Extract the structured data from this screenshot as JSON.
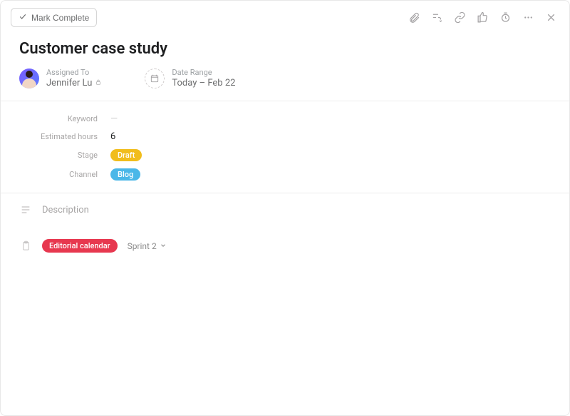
{
  "toolbar": {
    "mark_complete_label": "Mark Complete"
  },
  "task": {
    "title": "Customer case study",
    "assignee": {
      "label": "Assigned To",
      "name": "Jennifer Lu"
    },
    "date_range": {
      "label": "Date Range",
      "value": "Today – Feb 22"
    },
    "fields": {
      "keyword": {
        "label": "Keyword",
        "value": "—"
      },
      "estimated_hours": {
        "label": "Estimated hours",
        "value": "6"
      },
      "stage": {
        "label": "Stage",
        "pill": "Draft",
        "pill_color": "yellow"
      },
      "channel": {
        "label": "Channel",
        "pill": "Blog",
        "pill_color": "blue"
      }
    },
    "description_label": "Description",
    "project": {
      "name": "Editorial calendar",
      "section": "Sprint 2"
    }
  }
}
